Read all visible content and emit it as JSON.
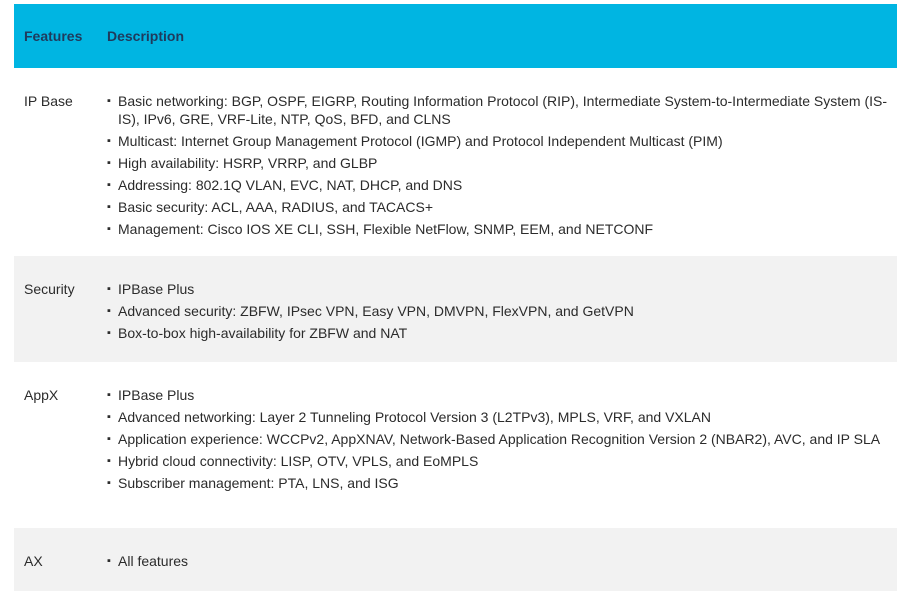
{
  "table": {
    "headers": {
      "features": "Features",
      "description": "Description"
    },
    "rows": [
      {
        "feature": "IP Base",
        "items": [
          "Basic networking: BGP, OSPF, EIGRP, Routing Information Protocol (RIP), Intermediate System-to-Intermediate System (IS-IS), IPv6, GRE, VRF-Lite, NTP, QoS, BFD, and CLNS",
          "Multicast: Internet Group Management Protocol (IGMP) and Protocol Independent Multicast (PIM)",
          "High availability: HSRP, VRRP, and GLBP",
          "Addressing: 802.1Q VLAN, EVC, NAT, DHCP, and DNS",
          "Basic security: ACL, AAA, RADIUS, and TACACS+",
          "Management: Cisco IOS XE CLI, SSH, Flexible NetFlow, SNMP, EEM, and NETCONF"
        ]
      },
      {
        "feature": "Security",
        "items": [
          "IPBase Plus",
          "Advanced security: ZBFW, IPsec VPN, Easy VPN, DMVPN, FlexVPN, and GetVPN",
          "Box-to-box high-availability for ZBFW and NAT"
        ]
      },
      {
        "feature": "AppX",
        "items": [
          "IPBase Plus",
          "Advanced networking: Layer 2 Tunneling Protocol Version 3 (L2TPv3), MPLS, VRF, and VXLAN",
          "Application experience: WCCPv2, AppXNAV, Network-Based Application Recognition Version 2 (NBAR2), AVC, and IP SLA",
          "Hybrid cloud connectivity: LISP, OTV, VPLS, and EoMPLS",
          "Subscriber management: PTA, LNS, and ISG"
        ]
      },
      {
        "feature": "AX",
        "items": [
          "All features"
        ]
      }
    ],
    "bullet": "▪"
  }
}
